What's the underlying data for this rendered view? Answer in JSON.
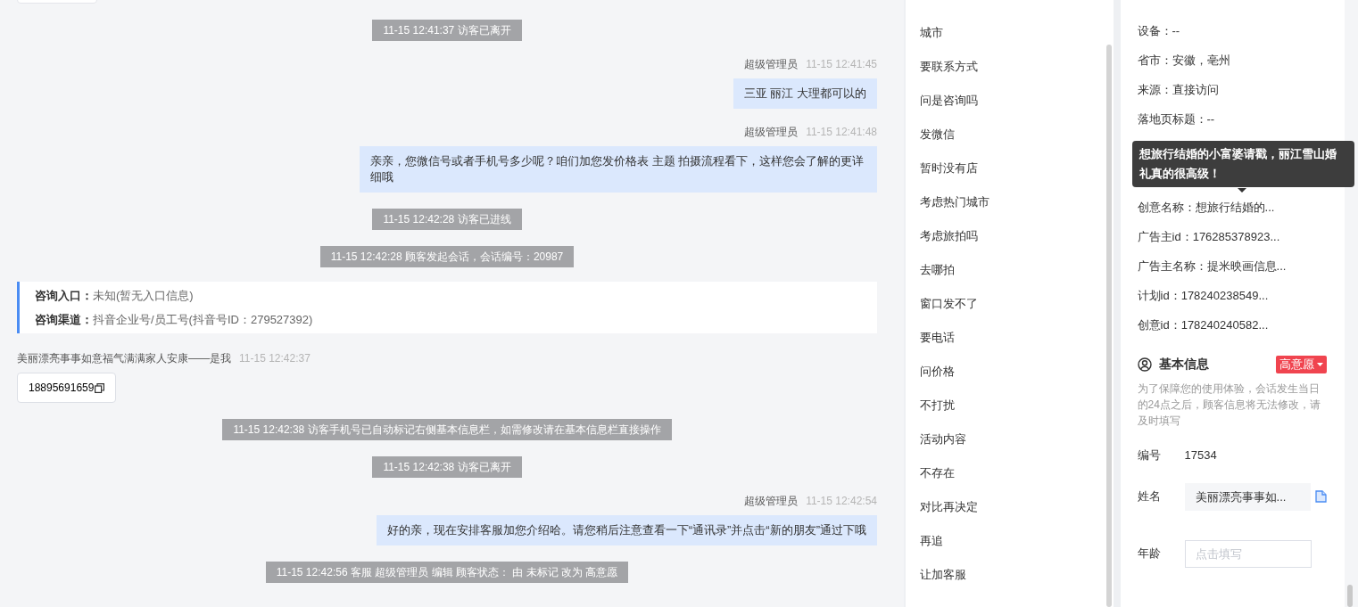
{
  "chat": {
    "messages": [
      {
        "kind": "system",
        "text": "11-15 12:41:37 访客已离开"
      },
      {
        "kind": "agent",
        "sender": "超级管理员",
        "time": "11-15 12:41:45",
        "text": "三亚  丽江 大理都可以的"
      },
      {
        "kind": "agent",
        "sender": "超级管理员",
        "time": "11-15 12:41:48",
        "text": "亲亲，您微信号或者手机号多少呢？咱们加您发价格表 主题 拍摄流程看下，这样您会了解的更详细哦"
      },
      {
        "kind": "system",
        "text": "11-15 12:42:28 访客已进线"
      },
      {
        "kind": "system",
        "text": "11-15 12:42:28 顾客发起会话，会话编号：20987"
      },
      {
        "kind": "info",
        "rows": [
          {
            "label": "咨询入口：",
            "value": "未知(暂无入口信息)"
          },
          {
            "label": "咨询渠道：",
            "value": "抖音企业号/员工号(抖音号ID：279527392)"
          }
        ]
      },
      {
        "kind": "visitor",
        "sender": "美丽漂亮事事如意福气满满家人安康——是我",
        "time": "11-15 12:42:37",
        "text": "18895691659"
      },
      {
        "kind": "system",
        "text": "11-15 12:42:38 访客手机号已自动标记右侧基本信息栏，如需修改请在基本信息栏直接操作"
      },
      {
        "kind": "system",
        "text": "11-15 12:42:38 访客已离开"
      },
      {
        "kind": "agent",
        "sender": "超级管理员",
        "time": "11-15 12:42:54",
        "text": "好的亲，现在安排客服加您介绍哈。请您稍后注意查看一下“通讯录”并点击“新的朋友”通过下哦"
      },
      {
        "kind": "system",
        "text": "11-15 12:42:56 客服 超级管理员 编辑 顾客状态：  由 未标记 改为 高意愿"
      }
    ]
  },
  "quick_replies": [
    "城市",
    "要联系方式",
    "问是咨询吗",
    "发微信",
    "暂时没有店",
    "考虑热门城市",
    "考虑旅拍吗",
    "去哪拍",
    "窗口发不了",
    "要电话",
    "问价格",
    "不打扰",
    "活动内容",
    "不存在",
    "对比再决定",
    "再追",
    "让加客服"
  ],
  "source_info": {
    "rows_top": [
      "设备：--",
      "省市：安徽，亳州",
      "来源：直接访问",
      "落地页标题：--"
    ],
    "rows_bottom": [
      "创意名称：想旅行结婚的...",
      "广告主id：176285378923...",
      "广告主名称：提米映画信息...",
      "计划id：178240238549...",
      "创意id：178240240582..."
    ],
    "tooltip": "想旅行结婚的小富婆请戳，丽江雪山婚礼真的很高级！"
  },
  "basic_info": {
    "title": "基本信息",
    "status": "高意愿",
    "note": "为了保障您的使用体验，会话发生当日的24点之后，顾客信息将无法修改，请及时填写",
    "fields": [
      {
        "kind": "text",
        "label": "编号",
        "value": "17534"
      },
      {
        "kind": "copy",
        "label": "姓名",
        "value": "美丽漂亮事事如..."
      },
      {
        "kind": "input",
        "label": "年龄",
        "placeholder": "点击填写"
      }
    ]
  }
}
